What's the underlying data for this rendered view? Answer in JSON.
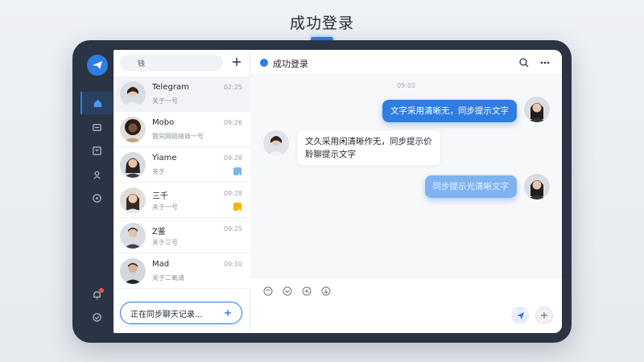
{
  "page": {
    "title": "成功登录"
  },
  "sidebar": {
    "search": {
      "value": "钱",
      "placeholder": ""
    },
    "contacts": [
      {
        "name": "Telegram",
        "preview": "关于一号",
        "time": "02:25",
        "selected": true
      },
      {
        "name": "Mobo",
        "preview": "我究网链接商一号",
        "time": "09:26"
      },
      {
        "name": "Yiame",
        "preview": "关于",
        "time": "09:28",
        "check": "#7fb2f0"
      },
      {
        "name": "三千",
        "preview": "关于一号",
        "time": "09:28",
        "check": "#f5b400"
      },
      {
        "name": "Z鉴",
        "preview": "关于三号",
        "time": "09:25"
      },
      {
        "name": "Mad",
        "preview": "关于二氧请",
        "time": "09:10"
      }
    ],
    "sync_label": "正在同步聊天记录..."
  },
  "chat": {
    "title": "成功登录",
    "timestamp": "09:03",
    "messages": [
      {
        "dir": "out",
        "text": "文字采用清晰无，同步提示文字"
      },
      {
        "dir": "in",
        "lines": [
          "文久采用闲清晰作无，同步提示价",
          "聆聊提示文字"
        ]
      },
      {
        "dir": "out",
        "text": "同步提示光清晰文字",
        "faded": true
      }
    ]
  },
  "colors": {
    "accent": "#2f7de1",
    "device": "#2b3444"
  }
}
